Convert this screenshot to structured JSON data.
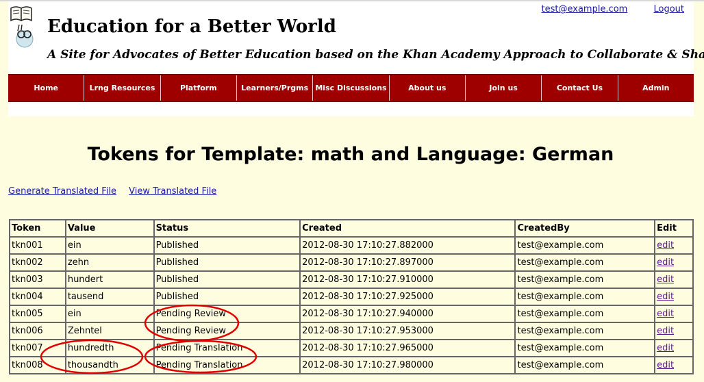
{
  "header": {
    "site_title": "Education for a Better World",
    "tagline": "A Site for Advocates of Better Education based on the Khan Academy Approach to Collaborate & Share",
    "user_email": "test@example.com",
    "logout_label": "Logout",
    "logo_icon": "book-reader-logo-icon"
  },
  "nav": {
    "items": [
      {
        "label": "Home"
      },
      {
        "label": "Lrng Resources"
      },
      {
        "label": "Platform"
      },
      {
        "label": "Learners/Prgms"
      },
      {
        "label": "Misc Discussions"
      },
      {
        "label": "About us"
      },
      {
        "label": "Join us"
      },
      {
        "label": "Contact Us"
      },
      {
        "label": "Admin"
      }
    ]
  },
  "main": {
    "heading": "Tokens for Template: math and Language: German",
    "generate_link": "Generate Translated File",
    "view_link": "View Translated File"
  },
  "table": {
    "headers": [
      "Token",
      "Value",
      "Status",
      "Created",
      "CreatedBy",
      "Edit"
    ],
    "rows": [
      {
        "token": "tkn001",
        "value": "ein",
        "status": "Published",
        "created": "2012-08-30 17:10:27.882000",
        "created_by": "test@example.com",
        "edit": "edit"
      },
      {
        "token": "tkn002",
        "value": "zehn",
        "status": "Published",
        "created": "2012-08-30 17:10:27.897000",
        "created_by": "test@example.com",
        "edit": "edit"
      },
      {
        "token": "tkn003",
        "value": "hundert",
        "status": "Published",
        "created": "2012-08-30 17:10:27.910000",
        "created_by": "test@example.com",
        "edit": "edit"
      },
      {
        "token": "tkn004",
        "value": "tausend",
        "status": "Published",
        "created": "2012-08-30 17:10:27.925000",
        "created_by": "test@example.com",
        "edit": "edit"
      },
      {
        "token": "tkn005",
        "value": "ein",
        "status": "Pending Review",
        "created": "2012-08-30 17:10:27.940000",
        "created_by": "test@example.com",
        "edit": "edit"
      },
      {
        "token": "tkn006",
        "value": "Zehntel",
        "status": "Pending Review",
        "created": "2012-08-30 17:10:27.953000",
        "created_by": "test@example.com",
        "edit": "edit"
      },
      {
        "token": "tkn007",
        "value": "hundredth",
        "status": "Pending Translation",
        "created": "2012-08-30 17:10:27.965000",
        "created_by": "test@example.com",
        "edit": "edit"
      },
      {
        "token": "tkn008",
        "value": "thousandth",
        "status": "Pending Translation",
        "created": "2012-08-30 17:10:27.980000",
        "created_by": "test@example.com",
        "edit": "edit"
      }
    ]
  },
  "colors": {
    "page_background": "#fffde0",
    "nav_background": "#9e0000",
    "annotation_ellipse": "#e00000",
    "link": "#1a1aa6"
  }
}
